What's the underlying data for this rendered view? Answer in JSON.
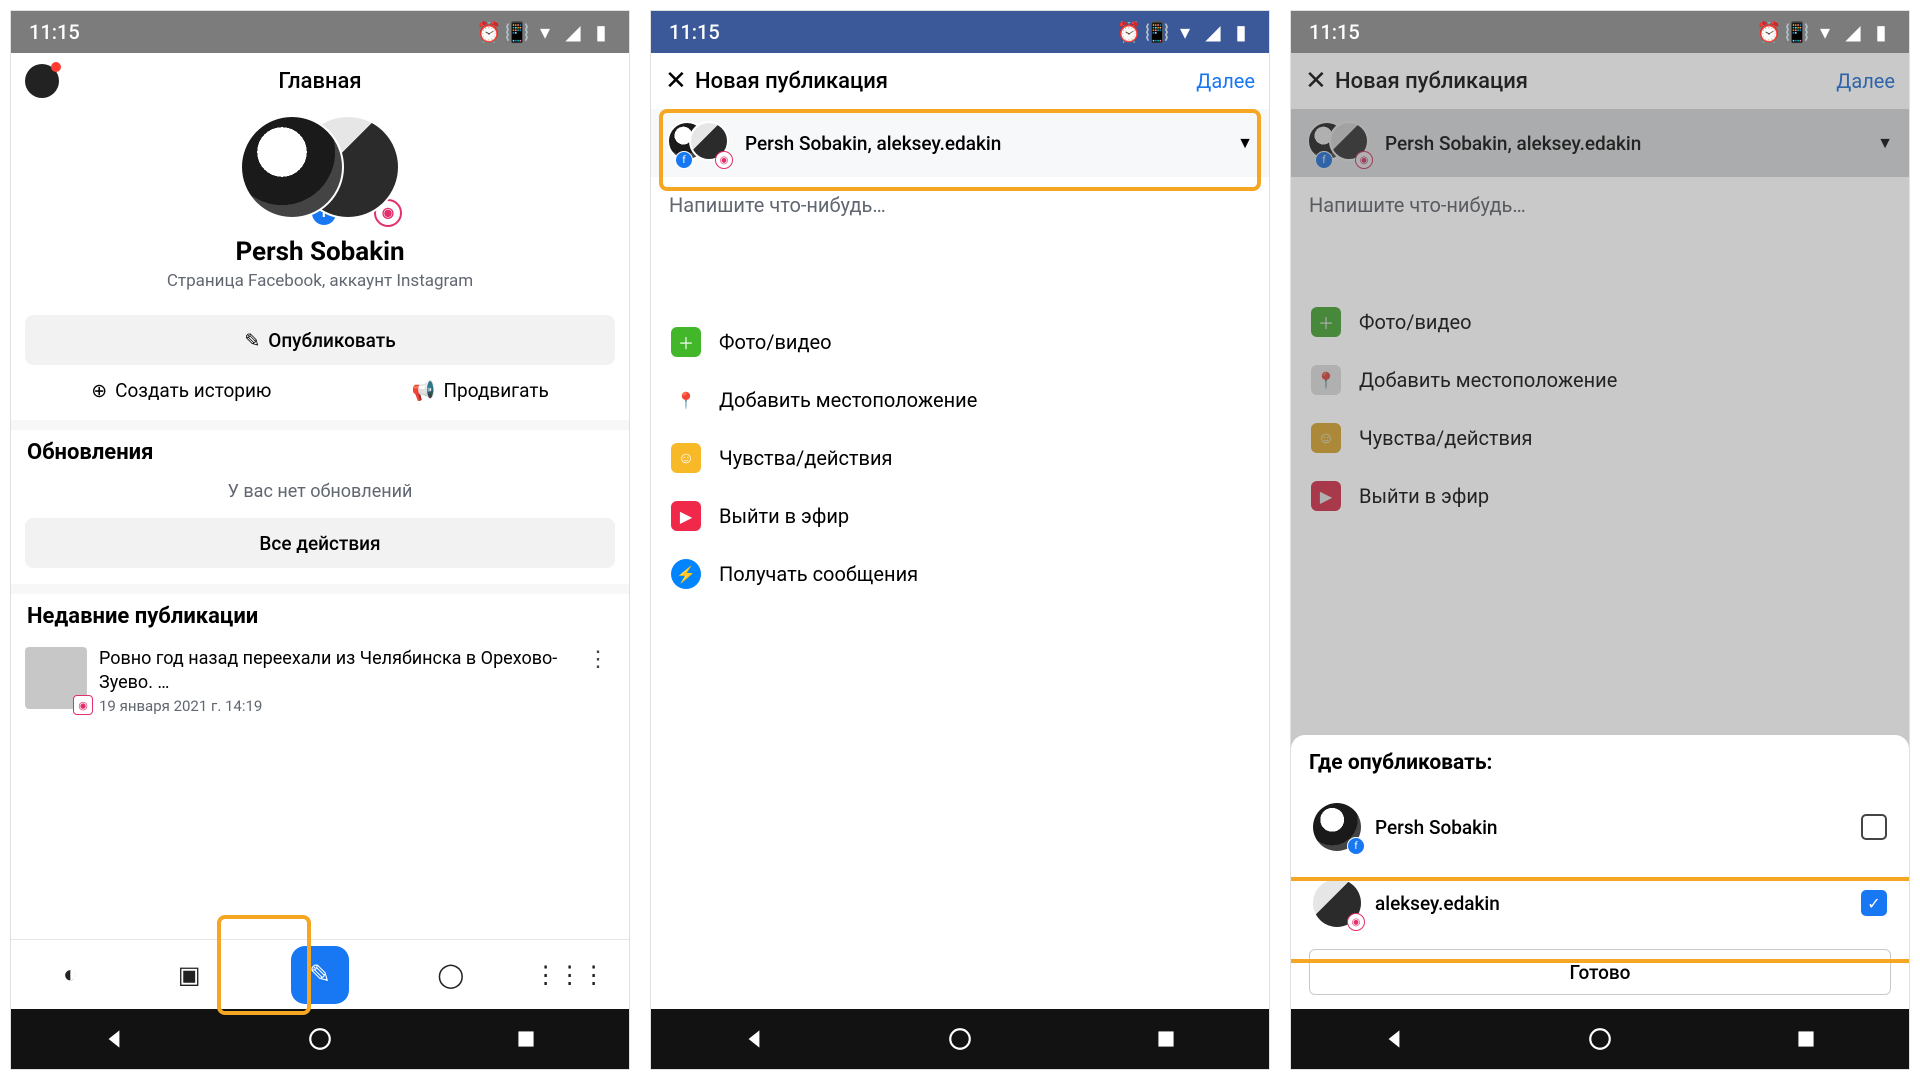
{
  "status": {
    "time": "11:15"
  },
  "screen1": {
    "header_title": "Главная",
    "profile_name": "Persh Sobakin",
    "profile_sub": "Страница Facebook, аккаунт Instagram",
    "publish_btn": "Опубликовать",
    "create_story": "Создать историю",
    "promote": "Продвигать",
    "updates_title": "Обновления",
    "no_updates": "У вас нет обновлений",
    "all_actions": "Все действия",
    "recent_title": "Недавние публикации",
    "post_text": "Ровно год назад переехали из Челябинска в Орехово-Зуево. …",
    "post_date": "19 января 2021 г. 14:19"
  },
  "screen2": {
    "header_title": "Новая публикация",
    "next": "Далее",
    "accounts_label": "Persh Sobakin, aleksey.edakin",
    "placeholder": "Напишите что-нибудь…",
    "opt_photo": "Фото/видео",
    "opt_location": "Добавить местоположение",
    "opt_feeling": "Чувства/действия",
    "opt_live": "Выйти в эфир",
    "opt_messages": "Получать сообщения"
  },
  "screen3": {
    "header_title": "Новая публикация",
    "next": "Далее",
    "accounts_label": "Persh Sobakin, aleksey.edakin",
    "placeholder": "Напишите что-нибудь…",
    "opt_photo": "Фото/видео",
    "opt_location": "Добавить местоположение",
    "opt_feeling": "Чувства/действия",
    "opt_live": "Выйти в эфир",
    "sheet_title": "Где опубликовать:",
    "item1": "Persh Sobakin",
    "item2": "aleksey.edakin",
    "done": "Готово"
  }
}
